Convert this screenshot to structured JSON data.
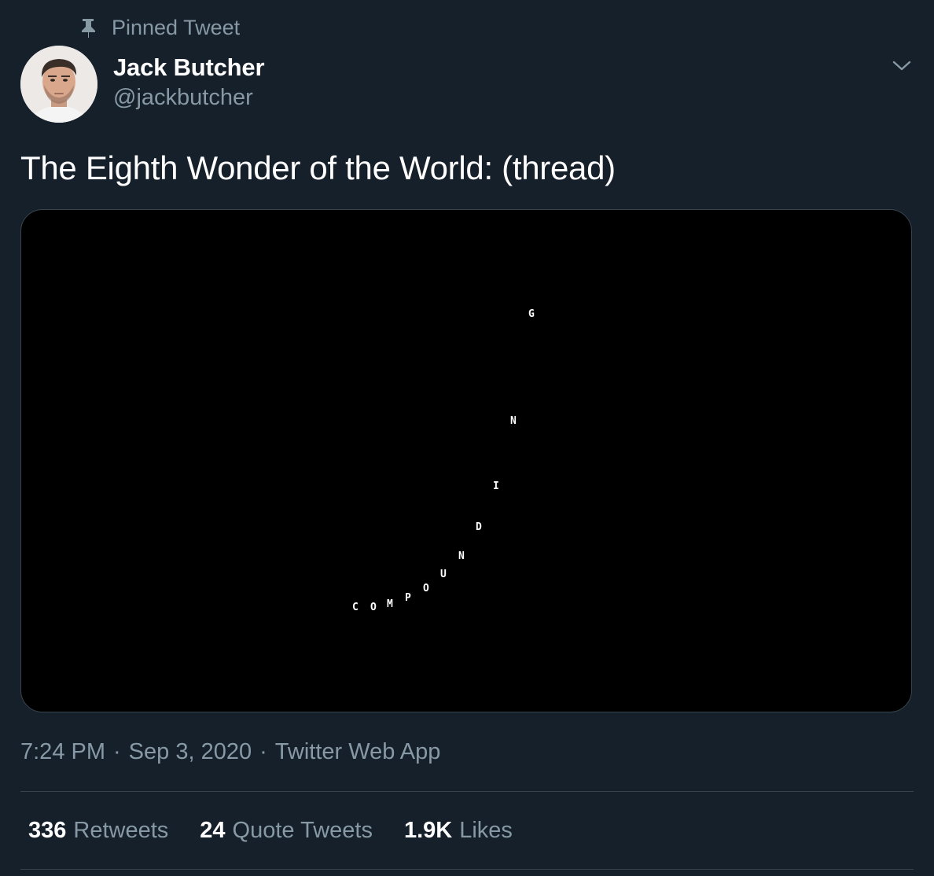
{
  "pinned": {
    "label": "Pinned Tweet",
    "icon": "pin-icon"
  },
  "author": {
    "name": "Jack Butcher",
    "handle": "@jackbutcher",
    "avatar_icon": "avatar"
  },
  "menu": {
    "icon": "chevron-down-icon"
  },
  "tweet": {
    "text": "The Eighth Wonder of the World: (thread)"
  },
  "media": {
    "letters": [
      "C",
      "O",
      "M",
      "P",
      "O",
      "U",
      "N",
      "D",
      "I",
      "N",
      "G"
    ]
  },
  "meta": {
    "time": "7:24 PM",
    "sep1": "·",
    "date": "Sep 3, 2020",
    "sep2": "·",
    "source": "Twitter Web App"
  },
  "stats": {
    "retweets_count": "336",
    "retweets_label": "Retweets",
    "quotes_count": "24",
    "quotes_label": "Quote Tweets",
    "likes_count": "1.9K",
    "likes_label": "Likes"
  },
  "colors": {
    "background": "#15202b",
    "secondary_text": "#8899a6",
    "border": "#38444d"
  }
}
